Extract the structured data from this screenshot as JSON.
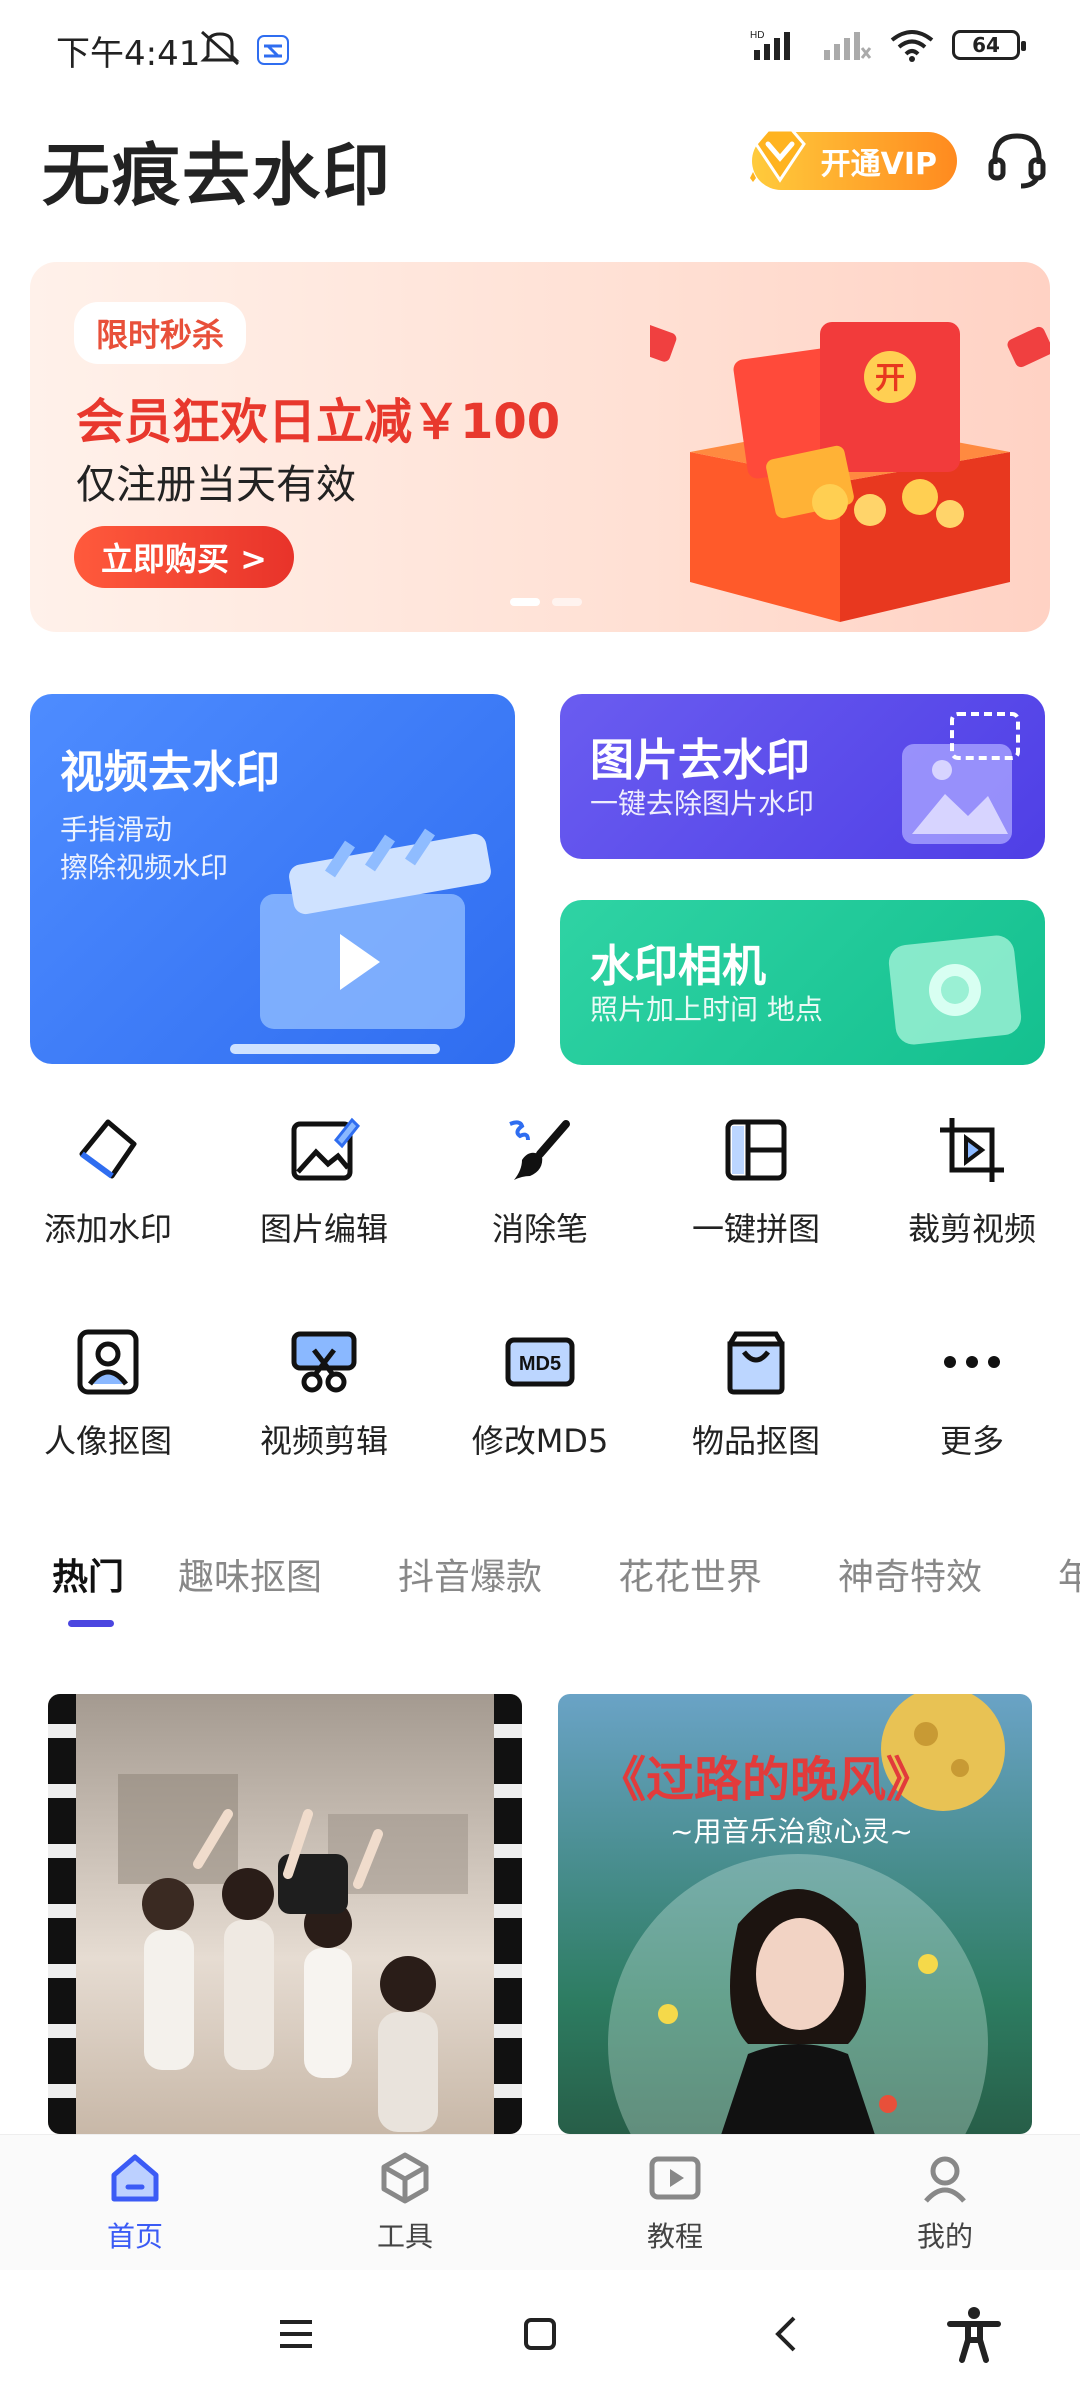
{
  "status": {
    "time": "下午4:41",
    "battery": "64"
  },
  "header": {
    "title": "无痕去水印",
    "vip_label": "开通VIP"
  },
  "banner": {
    "tag": "限时秒杀",
    "headline": "会员狂欢日立减￥100",
    "subline": "仅注册当天有效",
    "button": "立即购买 >",
    "gift_mark": "开",
    "page_count": 2,
    "active_page": 1
  },
  "cards": {
    "video": {
      "title": "视频去水印",
      "desc_line1": "手指滑动",
      "desc_line2": "擦除视频水印"
    },
    "image": {
      "title": "图片去水印",
      "desc": "一键去除图片水印"
    },
    "camera": {
      "title": "水印相机",
      "desc": "照片加上时间 地点"
    }
  },
  "tools_row1": [
    {
      "label": "添加水印",
      "icon": "add-watermark-icon"
    },
    {
      "label": "图片编辑",
      "icon": "image-edit-icon"
    },
    {
      "label": "消除笔",
      "icon": "eraser-brush-icon"
    },
    {
      "label": "一键拼图",
      "icon": "collage-icon"
    },
    {
      "label": "裁剪视频",
      "icon": "crop-video-icon"
    }
  ],
  "tools_row2": [
    {
      "label": "人像抠图",
      "icon": "portrait-cutout-icon"
    },
    {
      "label": "视频剪辑",
      "icon": "video-edit-icon"
    },
    {
      "label": "修改MD5",
      "icon": "md5-icon",
      "icon_text": "MD5"
    },
    {
      "label": "物品抠图",
      "icon": "object-cutout-icon"
    },
    {
      "label": "更多",
      "icon": "more-icon"
    }
  ],
  "tabs": [
    "热门",
    "趣味抠图",
    "抖音爆款",
    "花花世界",
    "神奇特效",
    "年"
  ],
  "active_tab": 0,
  "feed": {
    "item2_title": "《过路的晚风》",
    "item2_subtitle": "~用音乐治愈心灵~"
  },
  "bottom_nav": [
    {
      "label": "首页",
      "icon": "home-icon"
    },
    {
      "label": "工具",
      "icon": "tools-icon"
    },
    {
      "label": "教程",
      "icon": "tutorial-icon"
    },
    {
      "label": "我的",
      "icon": "profile-icon"
    }
  ],
  "active_nav": 0,
  "colors": {
    "accent": "#3b5bf5",
    "tab_indicator": "#4b46e0",
    "sale_red": "#e8382d",
    "video_card": "#2f6df0",
    "image_card": "#4f3fe6",
    "camera_card": "#14c08f"
  }
}
